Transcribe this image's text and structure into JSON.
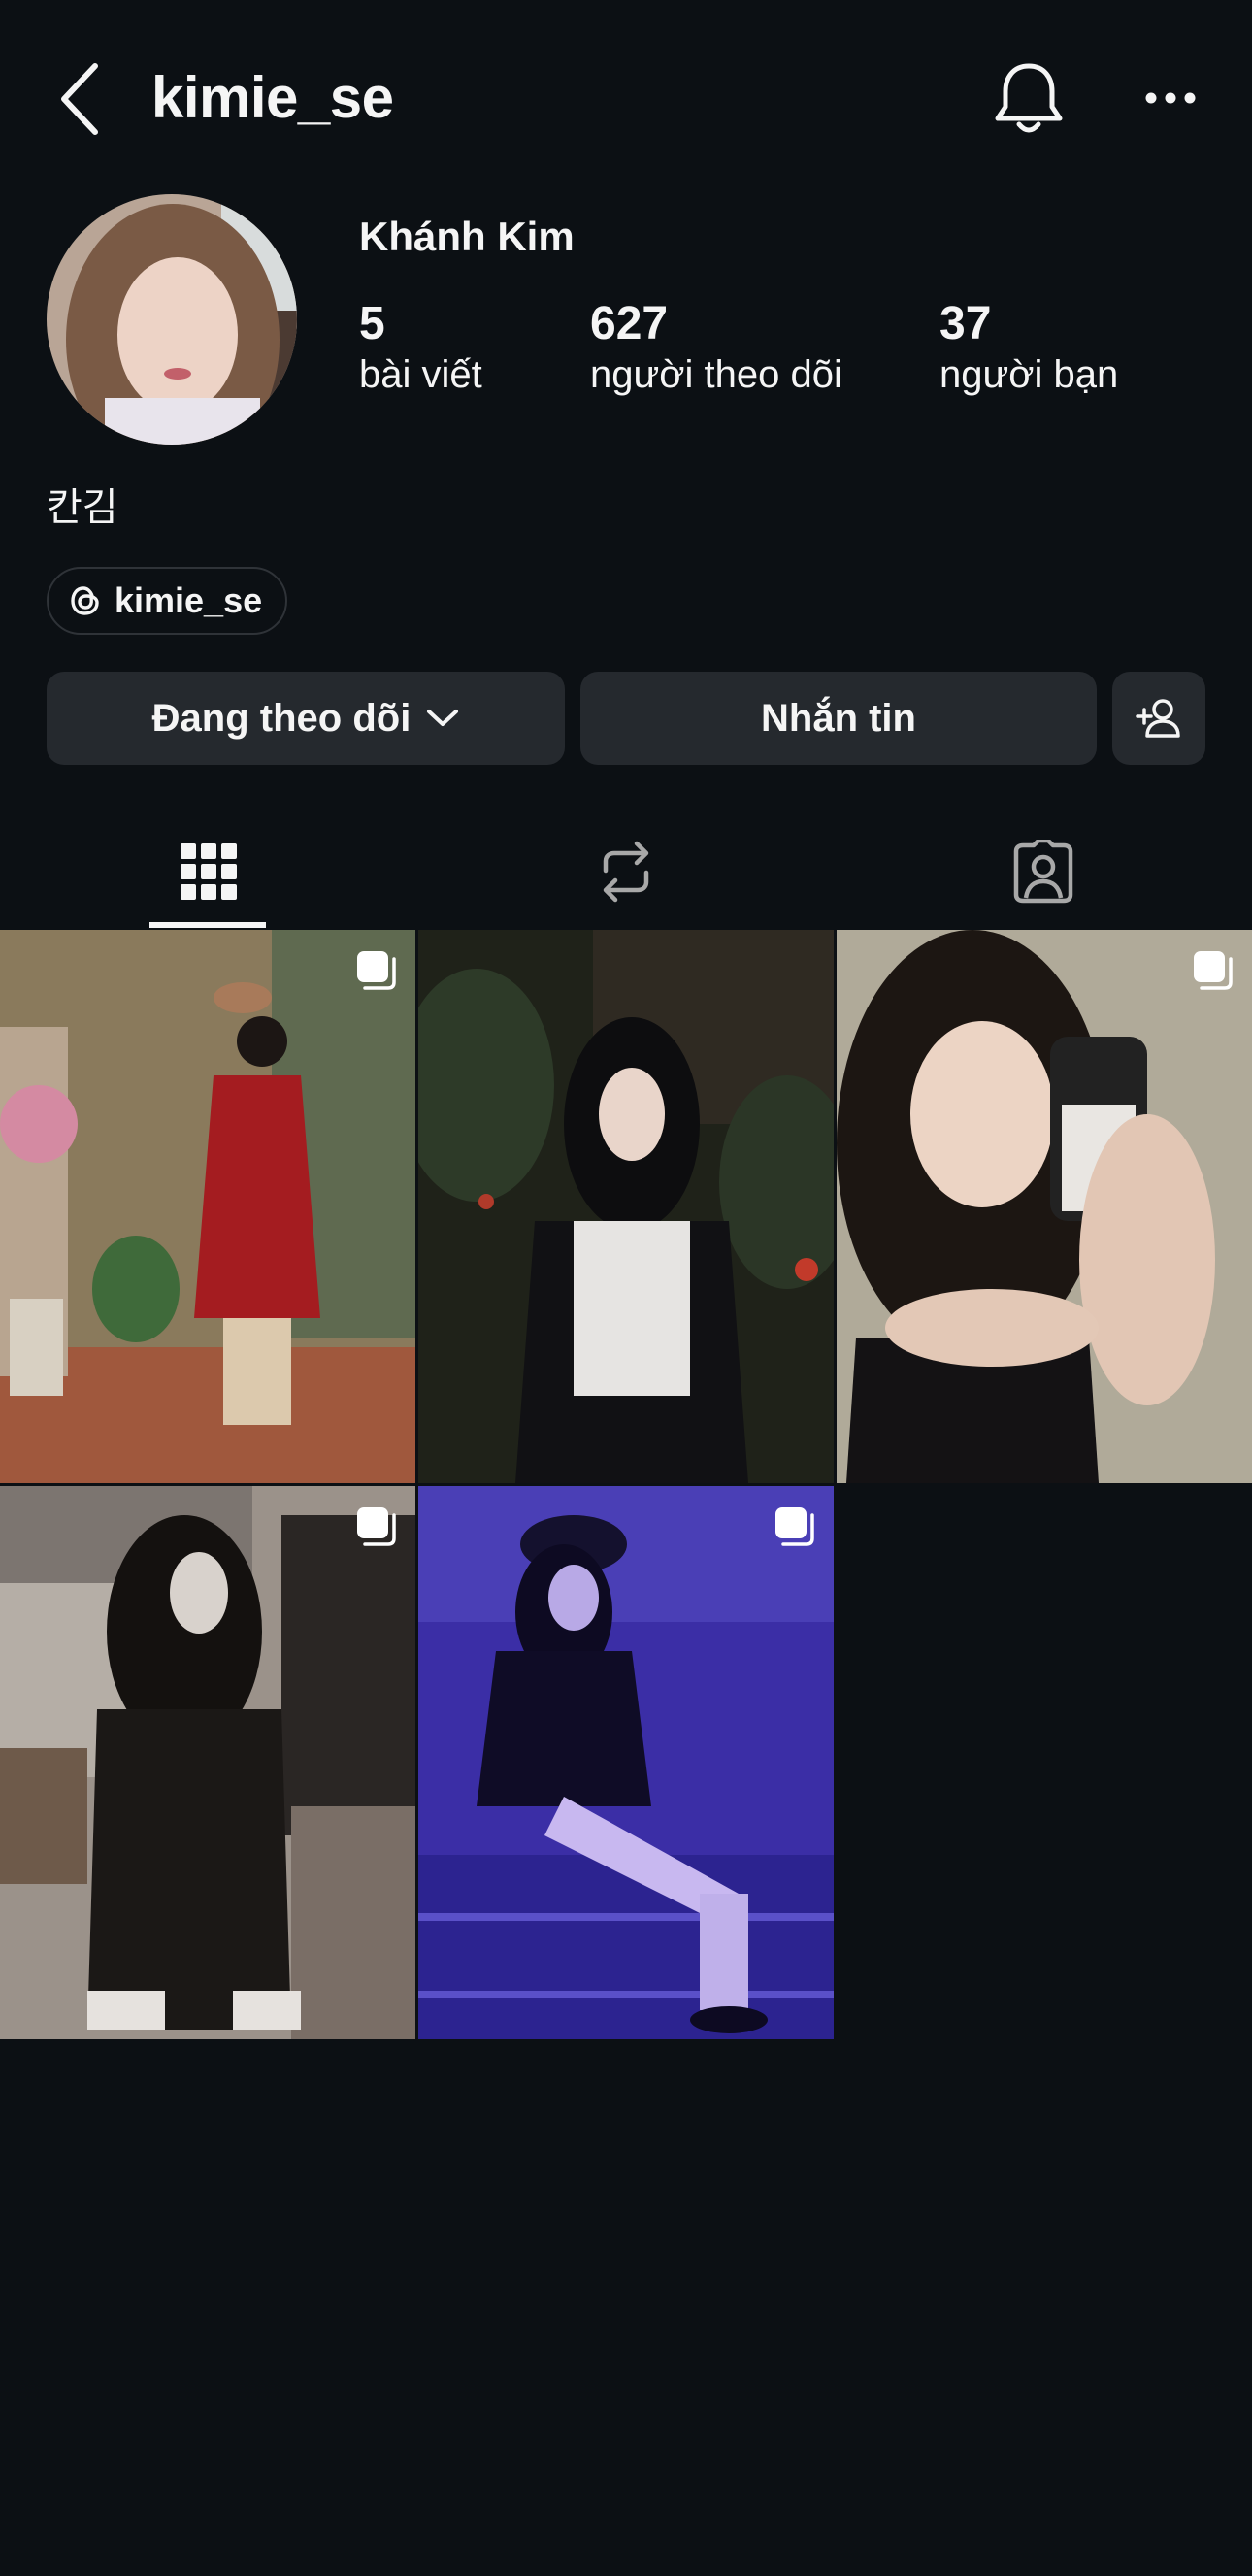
{
  "header": {
    "username": "kimie_se",
    "icons": {
      "back": "chevron-left-icon",
      "notify": "bell-icon",
      "more": "more-horizontal-icon"
    }
  },
  "profile": {
    "full_name": "Khánh Kim",
    "stats": [
      {
        "value": "5",
        "label": "bài viết"
      },
      {
        "value": "627",
        "label": "người theo dõi"
      },
      {
        "value": "37",
        "label": "người bạn"
      }
    ],
    "bio": "칸김",
    "threads_handle": "kimie_se"
  },
  "actions": {
    "following_label": "Đang theo dõi",
    "message_label": "Nhắn tin",
    "add_user_icon": "add-person-icon"
  },
  "tabs": [
    {
      "icon": "grid-icon",
      "active": true
    },
    {
      "icon": "repost-icon",
      "active": false
    },
    {
      "icon": "tagged-person-icon",
      "active": false
    }
  ],
  "posts": [
    {
      "carousel": true
    },
    {
      "carousel": false
    },
    {
      "carousel": true
    },
    {
      "carousel": true
    },
    {
      "carousel": true
    }
  ],
  "colors": {
    "background": "#0c1014",
    "button": "#25292e",
    "text": "#f5f5f5"
  }
}
